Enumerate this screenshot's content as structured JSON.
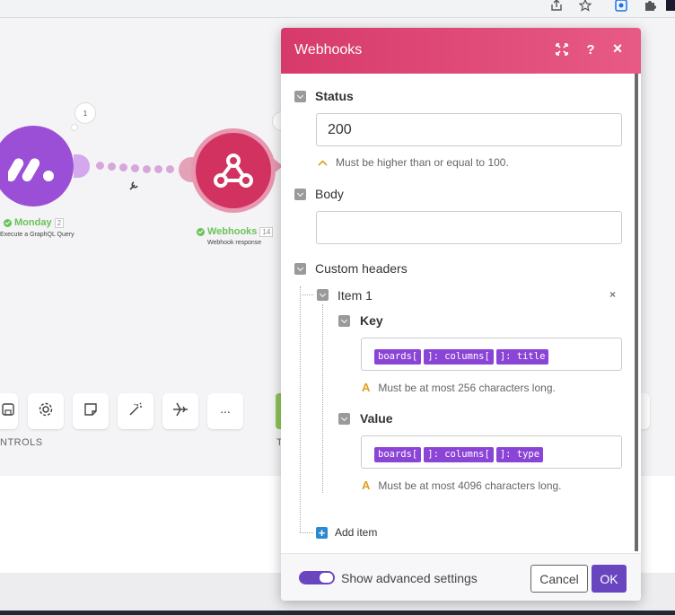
{
  "browser": {
    "icons": [
      "share-icon",
      "star-icon",
      "extension-icon",
      "puzzle-icon"
    ]
  },
  "scenario": {
    "modules": [
      {
        "name": "Monday",
        "subtitle": "Execute a GraphQL Query",
        "count": "2",
        "bubble": "1",
        "color": "#9b4fd6"
      },
      {
        "name": "Webhooks",
        "subtitle": "Webhook response",
        "count": "14",
        "color": "#d2325f"
      }
    ],
    "toolbar_icons": [
      "save-icon",
      "settings-icon",
      "notes-icon",
      "magic-wand-icon",
      "airplane-icon",
      "more-icon"
    ],
    "toolbar_more": "...",
    "controls_label": "NTROLS",
    "tools_label": "T"
  },
  "panel": {
    "title": "Webhooks",
    "header_icons": [
      "expand-icon",
      "help-icon",
      "close-icon"
    ],
    "help_label": "?",
    "close_label": "×",
    "status": {
      "label": "Status",
      "value": "200",
      "hint": "Must be higher than or equal to 100."
    },
    "body": {
      "label": "Body",
      "value": ""
    },
    "custom_headers": {
      "label": "Custom headers",
      "items": [
        {
          "label": "Item 1",
          "remove": "×",
          "key": {
            "label": "Key",
            "pills": [
              "boards[",
              "]: columns[",
              "]: title"
            ],
            "hint": "Must be at most 256 characters long."
          },
          "value": {
            "label": "Value",
            "pills": [
              "boards[",
              "]: columns[",
              "]: type"
            ],
            "hint": "Must be at most 4096 characters long."
          }
        }
      ],
      "add_item": "Add item"
    },
    "footer": {
      "advanced_label": "Show advanced settings",
      "advanced_on": true,
      "cancel": "Cancel",
      "ok": "OK"
    }
  },
  "colors": {
    "header_start": "#d63a6b",
    "header_end": "#e85a86",
    "accent": "#6a45c0",
    "pill": "#8a45d6",
    "monday": "#9b4fd6",
    "webhooks": "#d2325f"
  }
}
